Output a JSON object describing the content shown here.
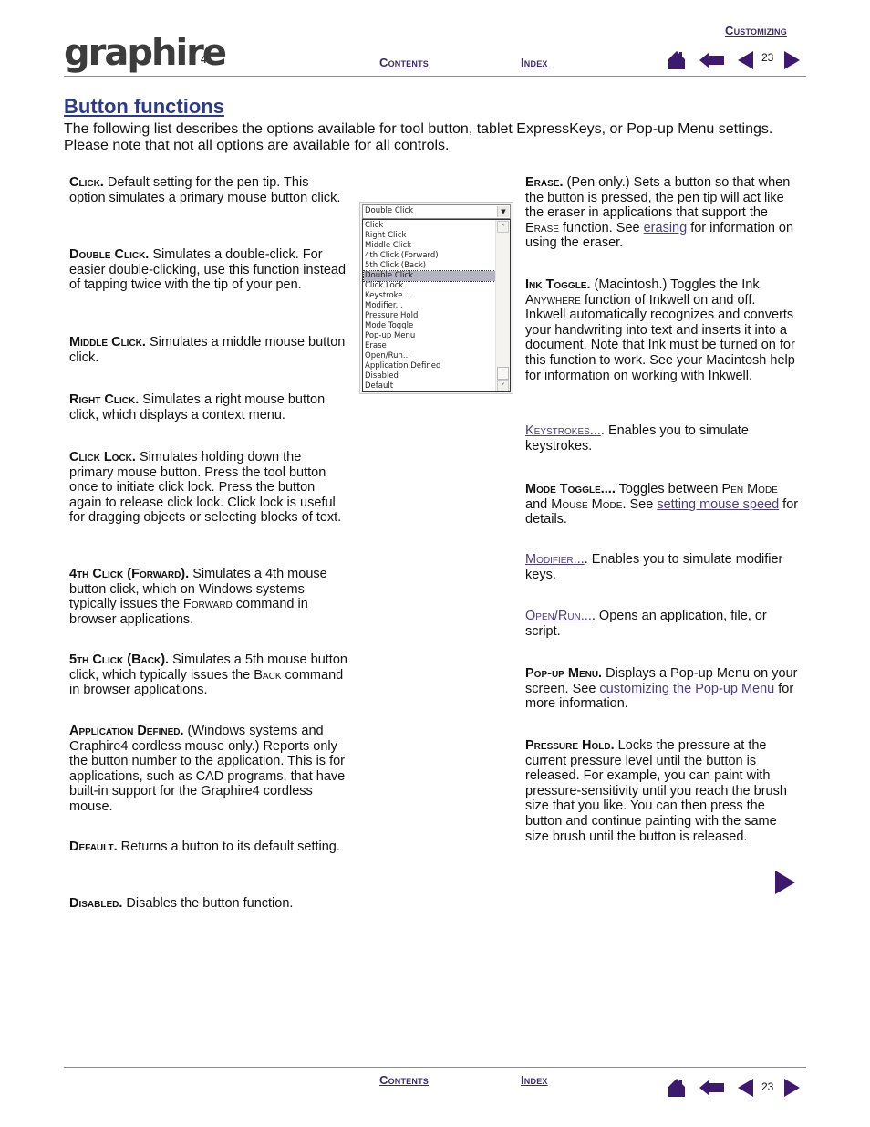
{
  "header": {
    "logo_text": "graphire",
    "logo_suffix": "4",
    "section_link": "Customizing",
    "contents_link": "Contents",
    "index_link": "Index",
    "page_number": "23"
  },
  "footer": {
    "contents_link": "Contents",
    "index_link": "Index",
    "page_number": "23"
  },
  "title": "Button functions",
  "intro": "The following list describes the options available for tool button, tablet ExpressKeys, or Pop-up Menu settings.  Please note that not all options are available for all controls.",
  "dropdown": {
    "selected": "Double Click",
    "highlighted_index": 5,
    "options": [
      "Click",
      "Right Click",
      "Middle Click",
      "4th Click (Forward)",
      "5th Click (Back)",
      "Double Click",
      "Click Lock",
      "Keystroke...",
      "Modifier...",
      "Pressure Hold",
      "Mode Toggle",
      "Pop-up Menu",
      "Erase",
      "Open/Run...",
      "Application Defined",
      "Disabled",
      "Default"
    ]
  },
  "left_column": [
    {
      "term": "Click.",
      "text": "  Default setting for the pen tip. This option simulates a primary mouse button click."
    },
    {
      "term": "Double Click.",
      "text": "  Simulates a double-click. For easier double-clicking, use this function instead of tapping twice with the tip of your pen."
    },
    {
      "term": "Middle Click.",
      "text": "  Simulates a middle mouse button click."
    },
    {
      "term": "Right Click.",
      "text": "  Simulates a right mouse button click, which displays a context menu."
    },
    {
      "term": "Click Lock.",
      "text": "  Simulates holding down the primary mouse button.  Press the tool button once to initiate click lock.  Press the button again to release click lock.  Click lock is useful for dragging objects or selecting blocks of text."
    },
    {
      "term": "4th Click (Forward).",
      "text": "  Simulates a 4th mouse button click, which on Windows systems typically issues the ",
      "sc": "Forward",
      "text2": " command in browser applications."
    },
    {
      "term": "5th Click (Back).",
      "text": "  Simulates a 5th mouse button click, which typically issues the ",
      "sc": "Back",
      "text2": " command in browser applications."
    },
    {
      "term": "Application Defined.",
      "text": "  (Windows systems and Graphire4 cordless mouse only.)  Reports only the button number to the application.  This is for applications, such as CAD programs, that have built-in support for the Graphire4 cordless mouse."
    },
    {
      "term": "Default.",
      "text": "  Returns a button to its default setting."
    },
    {
      "term": "Disabled.",
      "text": "  Disables the button function."
    }
  ],
  "right_column": {
    "erase": {
      "term": "Erase.",
      "text": "  (Pen only.)  Sets a button so that when the button is pressed, the pen tip will act like the eraser in applications that support the ",
      "sc": "Erase",
      "text2": " function.  See ",
      "link": "erasing",
      "text3": " for information on using the eraser."
    },
    "ink_toggle": {
      "term": "Ink Toggle.",
      "text": "  (Macintosh.)  Toggles the Ink ",
      "sc": "Anywhere",
      "text2": " function of Inkwell on and off.  Inkwell automatically recognizes and converts your handwriting into text and inserts it into a document.  Note that Ink must be turned on for this function to work.  See your Macintosh help for information on working with Inkwell."
    },
    "keystrokes": {
      "link": "Keystrokes...",
      "text": ".  Enables you to simulate keystrokes."
    },
    "mode_toggle": {
      "term": "Mode Toggle....",
      "text": "  Toggles between ",
      "sc1": "Pen Mode",
      "text2": " and ",
      "sc2": "Mouse Mode",
      "text3": ".  See ",
      "link": "setting mouse speed",
      "text4": " for details."
    },
    "modifier": {
      "link": "Modifier...",
      "text": ".  Enables you to simulate modifier keys."
    },
    "open_run": {
      "link": "Open/Run...",
      "text": ".  Opens an application, file, or script."
    },
    "popup_menu": {
      "term": "Pop-up Menu.",
      "text": "  Displays a Pop-up Menu on your screen.  See ",
      "link": "customizing the Pop-up Menu",
      "text2": " for more information."
    },
    "pressure_hold": {
      "term": "Pressure Hold.",
      "text": "  Locks the pressure at the current pressure level until the button is released.  For example, you can paint with pressure-sensitivity until you reach the brush size that you like. You can then press the button and continue painting with the same size brush until the button is released."
    }
  },
  "colors": {
    "nav_purple": "#3d1a6e",
    "link": "#4a3d80",
    "title": "#2b3a8a",
    "logo_dot": "#1c8ad6"
  }
}
